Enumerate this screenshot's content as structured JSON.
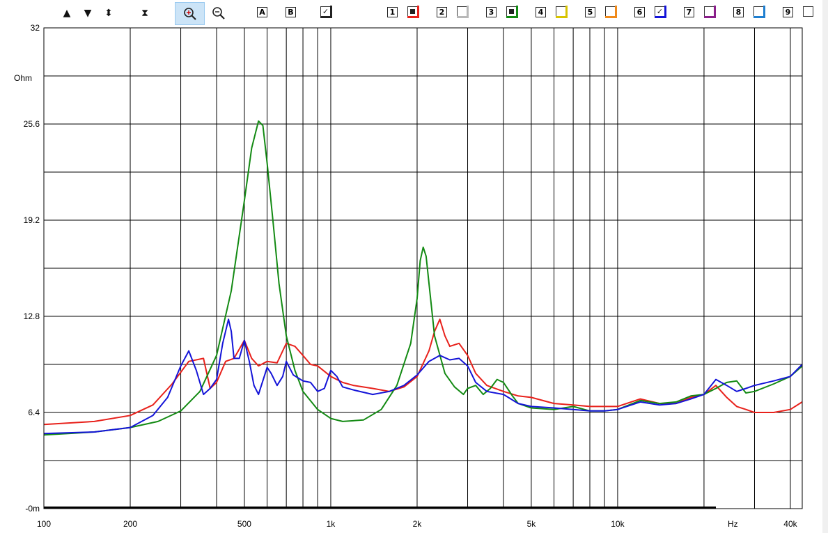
{
  "toolbar": {
    "nav_buttons": [
      {
        "name": "up-arrow-button",
        "glyph": "▲"
      },
      {
        "name": "down-arrow-button",
        "glyph": "▼"
      },
      {
        "name": "expand-vertical-button",
        "glyph": "⬍"
      },
      {
        "name": "compress-vertical-button",
        "glyph": "⧗"
      }
    ],
    "zoom_in_icon": "zoom-in-icon",
    "zoom_out_icon": "zoom-out-icon",
    "cursor_a_label": "A",
    "cursor_b_label": "B",
    "checkbox_icon": "checkbox-icon",
    "traces": [
      {
        "label": "1",
        "color": "#e8211b",
        "state": "filled"
      },
      {
        "label": "2",
        "color": "#b8b8b8",
        "state": "empty"
      },
      {
        "label": "3",
        "color": "#138a13",
        "state": "filled"
      },
      {
        "label": "4",
        "color": "#d8c400",
        "state": "empty"
      },
      {
        "label": "5",
        "color": "#f08a1a",
        "state": "empty"
      },
      {
        "label": "6",
        "color": "#1414d8",
        "state": "checked"
      },
      {
        "label": "7",
        "color": "#8a1f8a",
        "state": "empty"
      },
      {
        "label": "8",
        "color": "#1f7fd0",
        "state": "empty"
      },
      {
        "label": "9",
        "color": "#000000",
        "state": "empty"
      }
    ]
  },
  "chart_data": {
    "type": "line",
    "x_scale": "log",
    "xlim": [
      100,
      44000
    ],
    "ylim": [
      0,
      32
    ],
    "ylabel": "Ohm",
    "xlabel": "Hz",
    "grid": true,
    "y_ticks": [
      "32",
      "25.6",
      "19.2",
      "12.8",
      "6.4",
      "-0m"
    ],
    "y_tick_values": [
      32,
      25.6,
      19.2,
      12.8,
      6.4,
      0
    ],
    "x_ticks": [
      "100",
      "200",
      "500",
      "1k",
      "2k",
      "5k",
      "10k",
      "40k"
    ],
    "x_tick_values": [
      100,
      200,
      500,
      1000,
      2000,
      5000,
      10000,
      40000
    ],
    "series": [
      {
        "color": "#e8211b",
        "x": [
          100,
          150,
          200,
          240,
          280,
          320,
          360,
          380,
          400,
          430,
          460,
          500,
          530,
          560,
          600,
          650,
          700,
          750,
          800,
          850,
          900,
          1000,
          1100,
          1200,
          1400,
          1600,
          1800,
          2000,
          2200,
          2300,
          2400,
          2500,
          2600,
          2800,
          3000,
          3200,
          3500,
          4000,
          4500,
          5000,
          6000,
          7000,
          8000,
          9000,
          10000,
          12000,
          14000,
          16000,
          18000,
          20000,
          22000,
          24000,
          26000,
          28000,
          30000,
          35000,
          40000,
          44000
        ],
        "y": [
          5.6,
          5.8,
          6.2,
          6.9,
          8.3,
          9.8,
          10.0,
          8.0,
          8.4,
          9.8,
          10.0,
          11.2,
          10.0,
          9.5,
          9.8,
          9.7,
          11.0,
          10.8,
          10.2,
          9.6,
          9.5,
          8.8,
          8.4,
          8.2,
          8.0,
          7.8,
          8.1,
          8.8,
          10.5,
          11.8,
          12.6,
          11.5,
          10.8,
          11.0,
          10.2,
          9.0,
          8.2,
          7.8,
          7.5,
          7.4,
          7.0,
          6.9,
          6.8,
          6.8,
          6.8,
          7.3,
          7.0,
          7.0,
          7.4,
          7.6,
          8.2,
          7.4,
          6.8,
          6.6,
          6.4,
          6.4,
          6.6,
          7.1
        ]
      },
      {
        "color": "#138a13",
        "x": [
          100,
          150,
          200,
          250,
          300,
          350,
          400,
          450,
          500,
          530,
          560,
          580,
          600,
          630,
          660,
          700,
          750,
          800,
          900,
          1000,
          1100,
          1300,
          1500,
          1700,
          1900,
          2000,
          2050,
          2100,
          2150,
          2200,
          2300,
          2500,
          2700,
          2900,
          3000,
          3200,
          3400,
          3600,
          3800,
          4000,
          4300,
          4500,
          5000,
          6000,
          7000,
          8000,
          9000,
          10000,
          12000,
          14000,
          16000,
          18000,
          20000,
          22000,
          24000,
          26000,
          28000,
          30000,
          35000,
          40000,
          44000
        ],
        "y": [
          4.9,
          5.1,
          5.4,
          5.8,
          6.5,
          7.8,
          10.2,
          14.5,
          20.5,
          24.0,
          25.8,
          25.5,
          23.0,
          19.0,
          15.0,
          11.5,
          9.2,
          7.8,
          6.6,
          6.0,
          5.8,
          5.9,
          6.6,
          8.2,
          11.0,
          14.0,
          16.5,
          17.4,
          16.8,
          15.0,
          11.5,
          9.0,
          8.1,
          7.6,
          8.0,
          8.2,
          7.6,
          8.0,
          8.6,
          8.4,
          7.5,
          7.0,
          6.7,
          6.6,
          6.8,
          6.5,
          6.5,
          6.6,
          7.2,
          7.0,
          7.1,
          7.5,
          7.6,
          8.0,
          8.4,
          8.5,
          7.7,
          7.8,
          8.3,
          8.8,
          9.5
        ]
      },
      {
        "color": "#1414d8",
        "x": [
          100,
          150,
          200,
          240,
          270,
          300,
          320,
          340,
          360,
          380,
          400,
          420,
          440,
          450,
          460,
          480,
          500,
          520,
          540,
          560,
          600,
          620,
          650,
          680,
          700,
          740,
          800,
          850,
          900,
          950,
          1000,
          1050,
          1100,
          1200,
          1400,
          1600,
          1800,
          2000,
          2200,
          2400,
          2600,
          2800,
          3000,
          3200,
          3500,
          4000,
          4500,
          5000,
          6000,
          7000,
          8000,
          9000,
          10000,
          12000,
          14000,
          16000,
          18000,
          20000,
          22000,
          24000,
          26000,
          28000,
          30000,
          35000,
          40000,
          44000
        ],
        "y": [
          5.0,
          5.1,
          5.4,
          6.2,
          7.4,
          9.5,
          10.5,
          9.2,
          7.6,
          8.0,
          8.6,
          11.0,
          12.6,
          11.8,
          10.0,
          10.0,
          11.2,
          9.8,
          8.2,
          7.6,
          9.4,
          9.0,
          8.2,
          8.8,
          9.8,
          8.9,
          8.5,
          8.4,
          7.8,
          8.0,
          9.2,
          8.8,
          8.1,
          7.9,
          7.6,
          7.8,
          8.2,
          8.9,
          9.8,
          10.2,
          9.9,
          10.0,
          9.5,
          8.4,
          7.8,
          7.6,
          7.0,
          6.8,
          6.7,
          6.6,
          6.5,
          6.5,
          6.6,
          7.1,
          6.9,
          7.0,
          7.3,
          7.6,
          8.6,
          8.2,
          7.8,
          8.0,
          8.2,
          8.5,
          8.8,
          9.6
        ]
      }
    ]
  }
}
